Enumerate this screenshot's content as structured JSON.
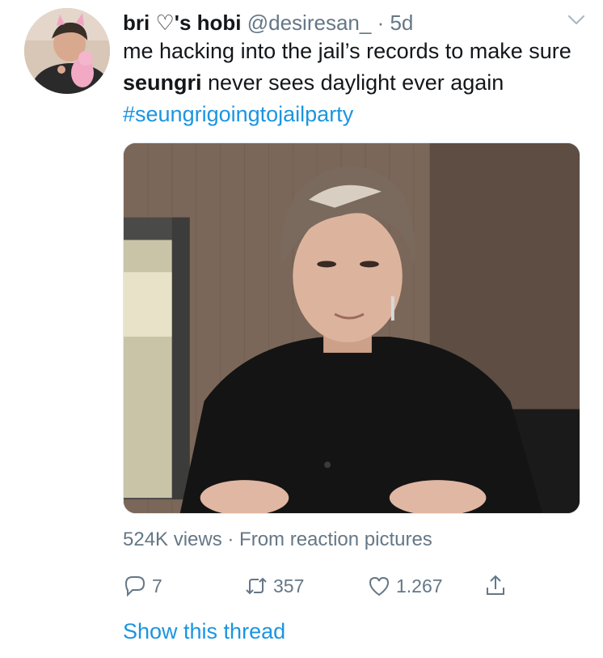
{
  "tweet": {
    "display_name": "bri ♡'s hobi",
    "handle": "@desiresan_",
    "dot": "·",
    "time": "5d",
    "text_part1": "me hacking into the jail’s records to make sure ",
    "text_bold": "seungri",
    "text_part2": " never sees daylight ever again ",
    "hashtag": "#seungrigoingtojailparty",
    "meta": "524K views · From reaction pictures",
    "replies": "7",
    "retweets": "357",
    "likes": "1.267",
    "show_thread": "Show this thread"
  },
  "icons": {
    "caret": "chevron-down-icon",
    "reply": "reply-icon",
    "retweet": "retweet-icon",
    "like": "heart-icon",
    "share": "share-icon"
  },
  "colors": {
    "link": "#1b95e0",
    "secondary": "#657786",
    "primary": "#14171a"
  }
}
